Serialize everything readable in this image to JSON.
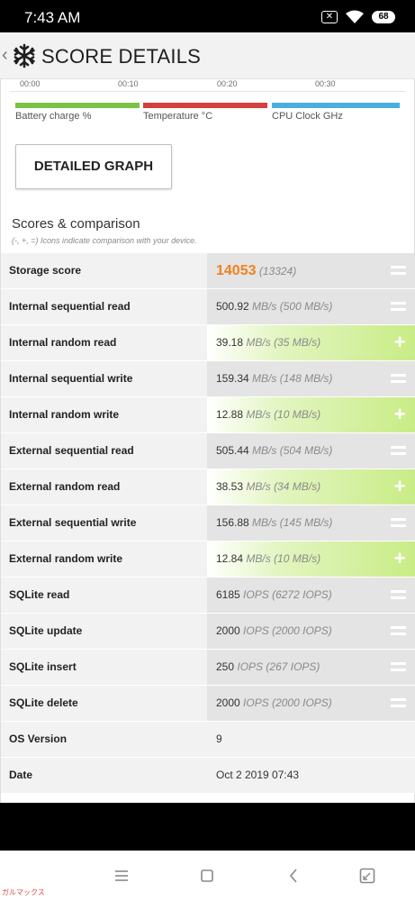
{
  "status_bar": {
    "time": "7:43 AM",
    "battery": "68",
    "icons": [
      "sim-blocked-icon",
      "wifi-icon",
      "battery-icon"
    ]
  },
  "header": {
    "title": "SCORE DETAILS",
    "back_icon": "chevron-left-icon",
    "app_icon": "snowflake-icon"
  },
  "graph": {
    "time_ticks": [
      "00:00",
      "00:10",
      "00:20",
      "00:30"
    ],
    "legend": [
      {
        "label": "Battery charge %",
        "color": "#7cc245"
      },
      {
        "label": "Temperature °C",
        "color": "#d43f3f"
      },
      {
        "label": "CPU Clock GHz",
        "color": "#4aaee0"
      }
    ],
    "detail_button": "DETAILED GRAPH"
  },
  "scores": {
    "title": "Scores & comparison",
    "subtitle": "(-, +, =) Icons indicate comparison with your device.",
    "rows": [
      {
        "label": "Storage score",
        "value": "14053",
        "unit": "",
        "compare": "(13324)",
        "indicator": "equal"
      },
      {
        "label": "Internal sequential read",
        "value": "500.92",
        "unit": "MB/s",
        "compare": "(500 MB/s)",
        "indicator": "equal"
      },
      {
        "label": "Internal random read",
        "value": "39.18",
        "unit": "MB/s",
        "compare": "(35 MB/s)",
        "indicator": "better"
      },
      {
        "label": "Internal sequential write",
        "value": "159.34",
        "unit": "MB/s",
        "compare": "(148 MB/s)",
        "indicator": "equal"
      },
      {
        "label": "Internal random write",
        "value": "12.88",
        "unit": "MB/s",
        "compare": "(10 MB/s)",
        "indicator": "better"
      },
      {
        "label": "External sequential read",
        "value": "505.44",
        "unit": "MB/s",
        "compare": "(504 MB/s)",
        "indicator": "equal"
      },
      {
        "label": "External random read",
        "value": "38.53",
        "unit": "MB/s",
        "compare": "(34 MB/s)",
        "indicator": "better"
      },
      {
        "label": "External sequential write",
        "value": "156.88",
        "unit": "MB/s",
        "compare": "(145 MB/s)",
        "indicator": "equal"
      },
      {
        "label": "External random write",
        "value": "12.84",
        "unit": "MB/s",
        "compare": "(10 MB/s)",
        "indicator": "better"
      },
      {
        "label": "SQLite read",
        "value": "6185",
        "unit": "IOPS",
        "compare": "(6272 IOPS)",
        "indicator": "equal"
      },
      {
        "label": "SQLite update",
        "value": "2000",
        "unit": "IOPS",
        "compare": "(2000 IOPS)",
        "indicator": "equal"
      },
      {
        "label": "SQLite insert",
        "value": "250",
        "unit": "IOPS",
        "compare": "(267 IOPS)",
        "indicator": "equal"
      },
      {
        "label": "SQLite delete",
        "value": "2000",
        "unit": "IOPS",
        "compare": "(2000 IOPS)",
        "indicator": "equal"
      },
      {
        "label": "OS Version",
        "value": "9",
        "unit": "",
        "compare": "",
        "indicator": "none"
      },
      {
        "label": "Date",
        "value": "Oct 2 2019 07:43",
        "unit": "",
        "compare": "",
        "indicator": "none"
      }
    ]
  },
  "nav_bar": {
    "icons": [
      "menu-icon",
      "home-icon",
      "back-icon",
      "screenshot-icon"
    ]
  },
  "watermark": "ガルマックス"
}
